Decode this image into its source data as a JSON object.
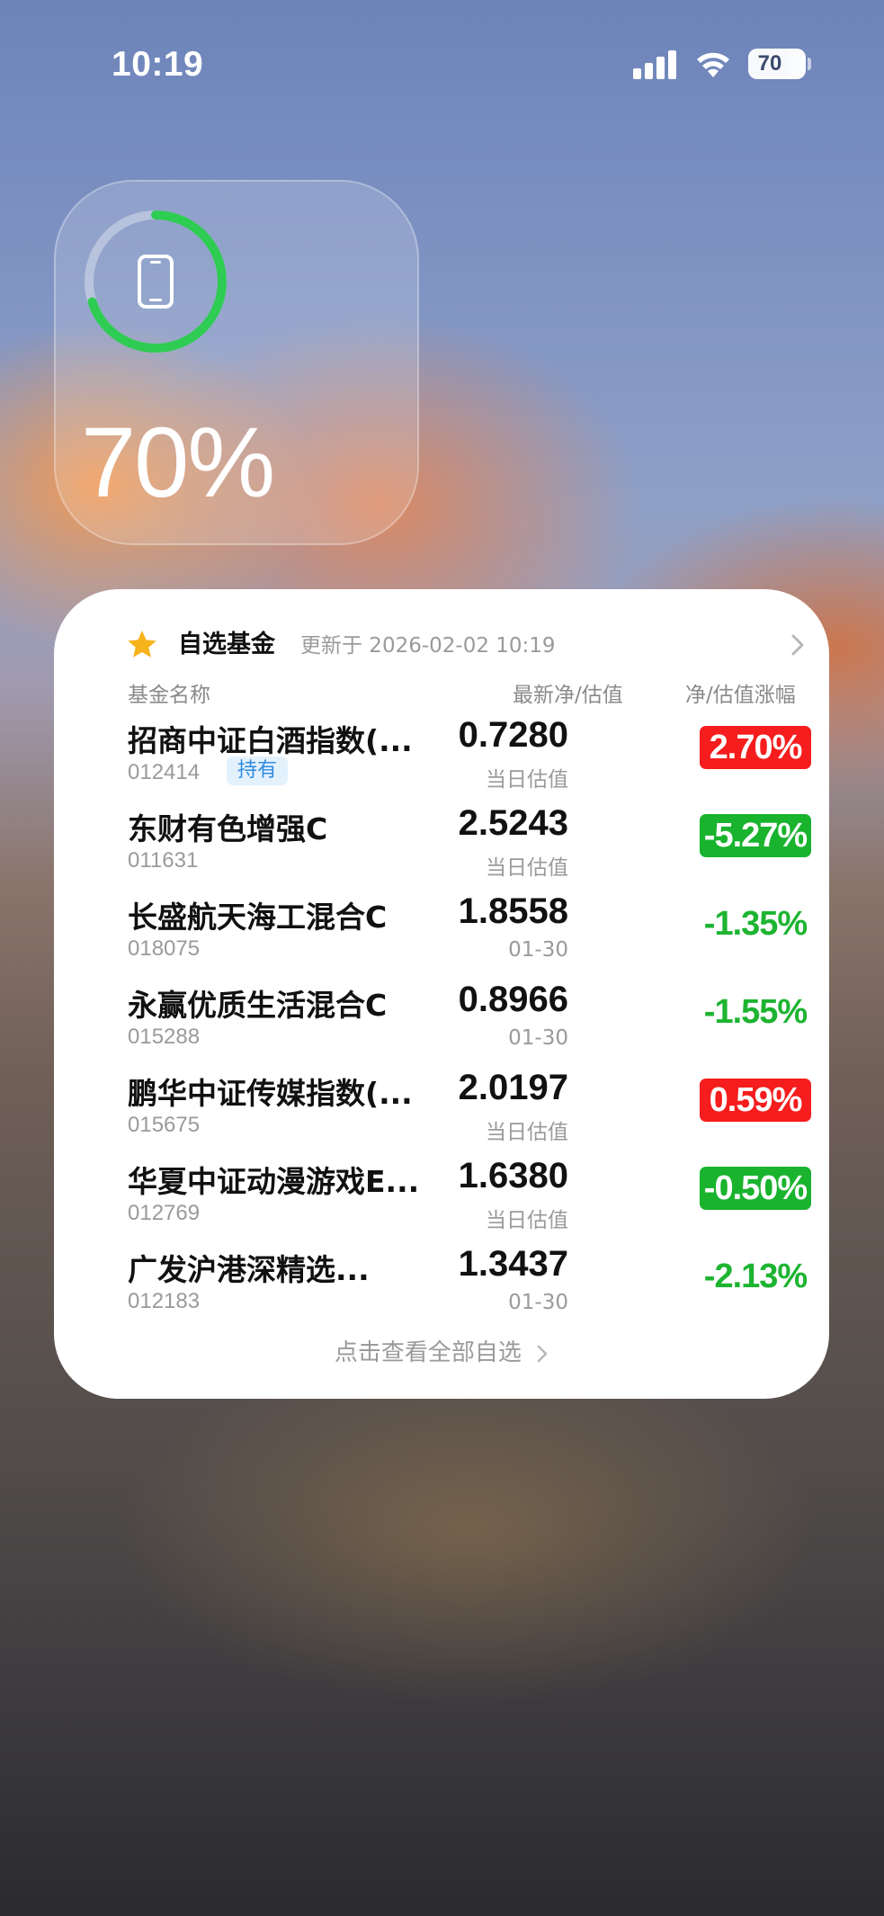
{
  "status_bar": {
    "time": "10:19",
    "battery_level": "70"
  },
  "battery_widget": {
    "percent_text": "70%",
    "percent_value": 0.7,
    "ring_color": "#2ecc52",
    "icon": "phone-icon"
  },
  "fund_widget": {
    "icon": "star-icon",
    "title": "自选基金",
    "updated": "更新于 2026-02-02 10:19",
    "columns": {
      "name": "基金名称",
      "nav": "最新净/估值",
      "change": "净/估值涨幅"
    },
    "funds": [
      {
        "name": "招商中证白酒指数(...",
        "code": "012414",
        "tag": "持有",
        "nav": "0.7280",
        "nav_label": "当日估值",
        "change": "2.70%",
        "style": "up"
      },
      {
        "name": "东财有色增强C",
        "code": "011631",
        "tag": "",
        "nav": "2.5243",
        "nav_label": "当日估值",
        "change": "-5.27%",
        "style": "down"
      },
      {
        "name": "长盛航天海工混合C",
        "code": "018075",
        "tag": "",
        "nav": "1.8558",
        "nav_label": "01-30",
        "change": "-1.35%",
        "style": "down-text"
      },
      {
        "name": "永赢优质生活混合C",
        "code": "015288",
        "tag": "",
        "nav": "0.8966",
        "nav_label": "01-30",
        "change": "-1.55%",
        "style": "down-text"
      },
      {
        "name": "鹏华中证传媒指数(...",
        "code": "015675",
        "tag": "",
        "nav": "2.0197",
        "nav_label": "当日估值",
        "change": "0.59%",
        "style": "up"
      },
      {
        "name": "华夏中证动漫游戏E...",
        "code": "012769",
        "tag": "",
        "nav": "1.6380",
        "nav_label": "当日估值",
        "change": "-0.50%",
        "style": "down"
      },
      {
        "name": "广发沪港深精选...",
        "code": "012183",
        "tag": "",
        "nav": "1.3437",
        "nav_label": "01-30",
        "change": "-2.13%",
        "style": "down-text"
      }
    ],
    "footer": "点击查看全部自选",
    "colors": {
      "up": "#f51d1d",
      "down": "#19b32e",
      "down_text": "#1db431",
      "tag_text": "#2f8be0",
      "tag_bg": "#e3f1fc"
    }
  }
}
